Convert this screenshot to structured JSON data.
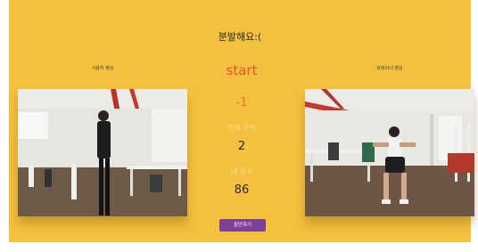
{
  "headline": "분발해요:(",
  "user_cam": {
    "label": "사용자 영상"
  },
  "trainer_cam": {
    "label": "트레이너 영상"
  },
  "status": {
    "start": "start",
    "score_delta": "-1",
    "rank_label": "현재 순위",
    "rank_value": "2",
    "my_score_label": "내 점수",
    "my_score_value": "86"
  },
  "stop_button": {
    "label": "중단하기"
  },
  "colors": {
    "background": "#f4c13e",
    "start": "#e4542a",
    "score_delta": "#e8742c",
    "button": "#7e3f96"
  }
}
